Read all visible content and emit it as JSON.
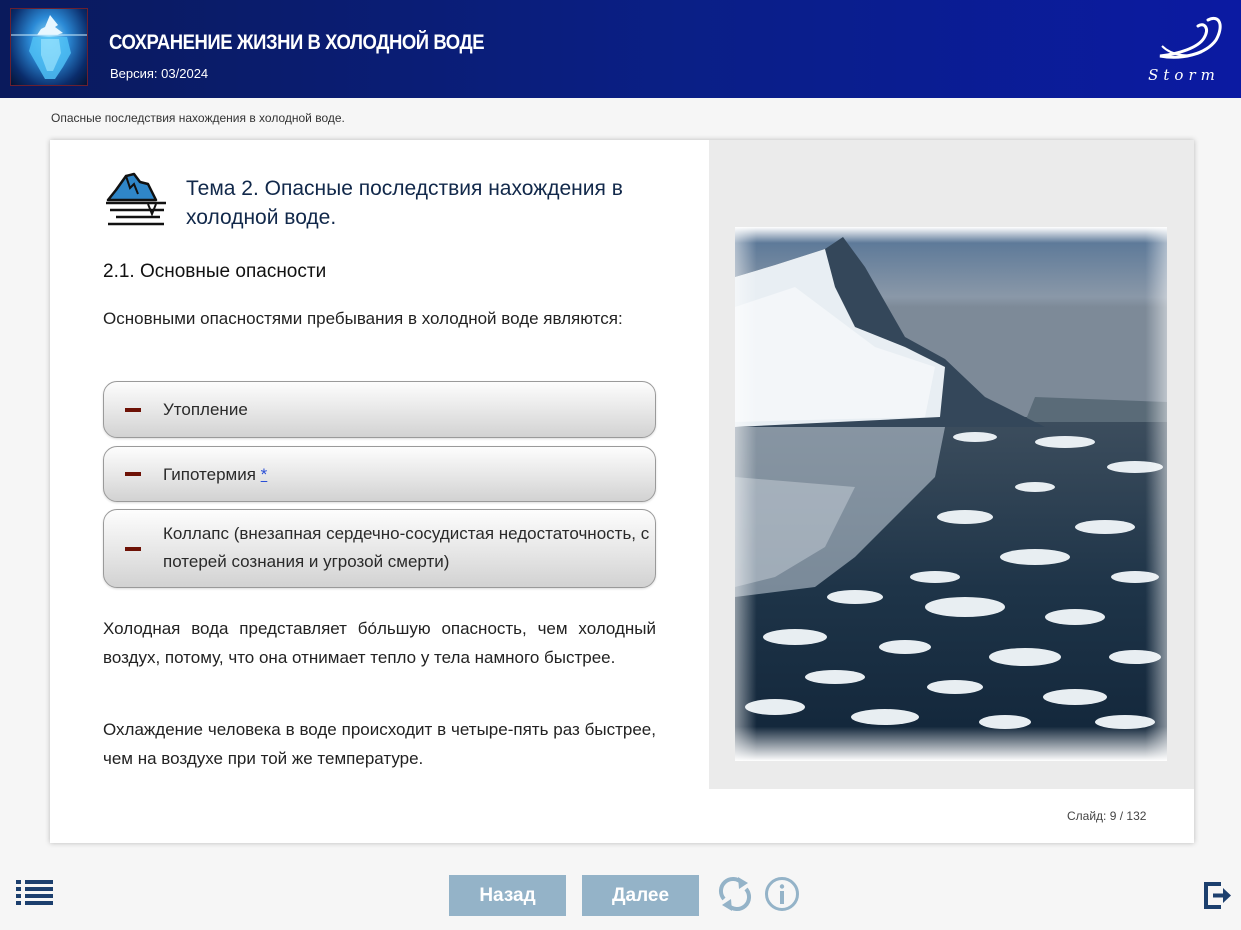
{
  "header": {
    "title": "СОХРАНЕНИЕ ЖИЗНИ В ХОЛОДНОЙ ВОДЕ",
    "version": "Версия: 03/2024",
    "brand": "Storm"
  },
  "breadcrumb": "Опасные последствия нахождения в холодной воде.",
  "slide": {
    "topic_title": "Тема 2. Опасные последствия нахождения в холодной воде.",
    "section_title": "2.1. Основные опасности",
    "intro": "Основными опасностями пребывания в холодной воде являются:",
    "hazards": [
      {
        "label": "Утопление"
      },
      {
        "label": "Гипотермия",
        "footnote": "*"
      },
      {
        "label": "Коллапс (внезапная сердечно-сосудистая недостаточность, с потерей сознания и угрозой смерти)"
      }
    ],
    "paragraphs": [
      "Холодная вода представляет бо́льшую опасность, чем холодный воздух, потому, что она отнимает тепло у тела намного быстрее.",
      "Охлаждение человека в воде происходит в четыре-пять раз быстрее, чем на воздухе при той же температуре."
    ],
    "counter": "Слайд:  9 / 132"
  },
  "footer": {
    "back_label": "Назад",
    "next_label": "Далее"
  },
  "colors": {
    "header_dark": "#0a1a5c",
    "header_light": "#0b1aa2",
    "button": "#94b3c8",
    "icon": "#1c3f6e",
    "dash": "#6e1206"
  },
  "icons": [
    "menu-icon",
    "reload-icon",
    "info-icon",
    "exit-icon",
    "iceberg-icon"
  ]
}
